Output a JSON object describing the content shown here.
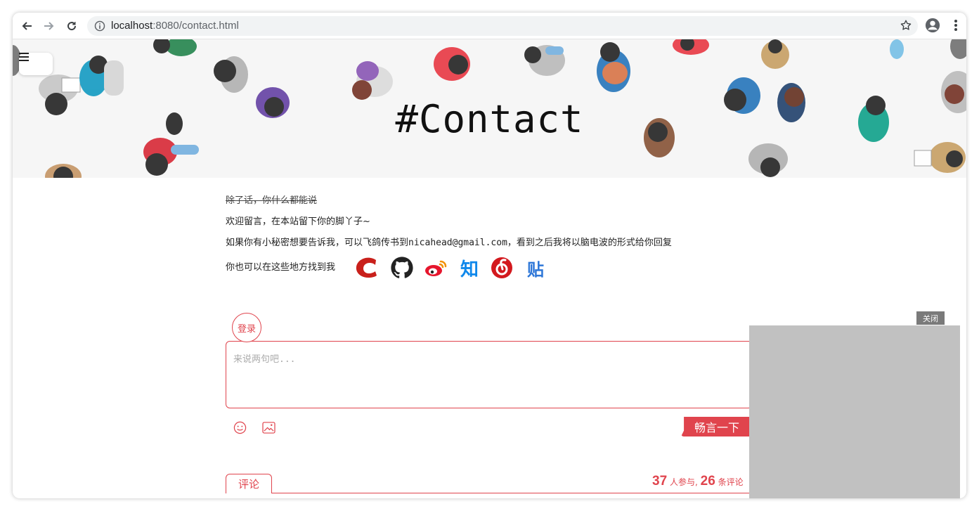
{
  "browser": {
    "url_host": "localhost",
    "url_rest": ":8080/contact.html"
  },
  "hero": {
    "title": "#Contact"
  },
  "content": {
    "strike_text": "除了话，你什么都能说",
    "welcome_text": "欢迎留言，在本站留下你的脚丫子~",
    "secret_prefix": "如果你有小秘密想要告诉我，可以飞鸽传书到",
    "email": "nicahead@gmail.com",
    "secret_suffix": "，看到之后我将以脑电波的形式给你回复",
    "find_text": "你也可以在这些地方找到我",
    "socials": [
      {
        "name": "csdn",
        "color": "#c9201b"
      },
      {
        "name": "github",
        "color": "#222222"
      },
      {
        "name": "weibo",
        "color": "#e6162d"
      },
      {
        "name": "zhihu",
        "label": "知",
        "color": "#0f88eb"
      },
      {
        "name": "netease-music",
        "color": "#d3191e"
      },
      {
        "name": "tieba",
        "label": "贴",
        "color": "#2e77d8"
      }
    ]
  },
  "comment": {
    "login_label": "登录",
    "placeholder": "来说两句吧...",
    "submit_label": "畅言一下",
    "tab_label": "评论",
    "participants": "37",
    "participants_label": "人参与,",
    "comments": "26",
    "comments_label": "条评论",
    "accent_color": "#e0444d"
  },
  "ad": {
    "close_label": "关闭"
  }
}
